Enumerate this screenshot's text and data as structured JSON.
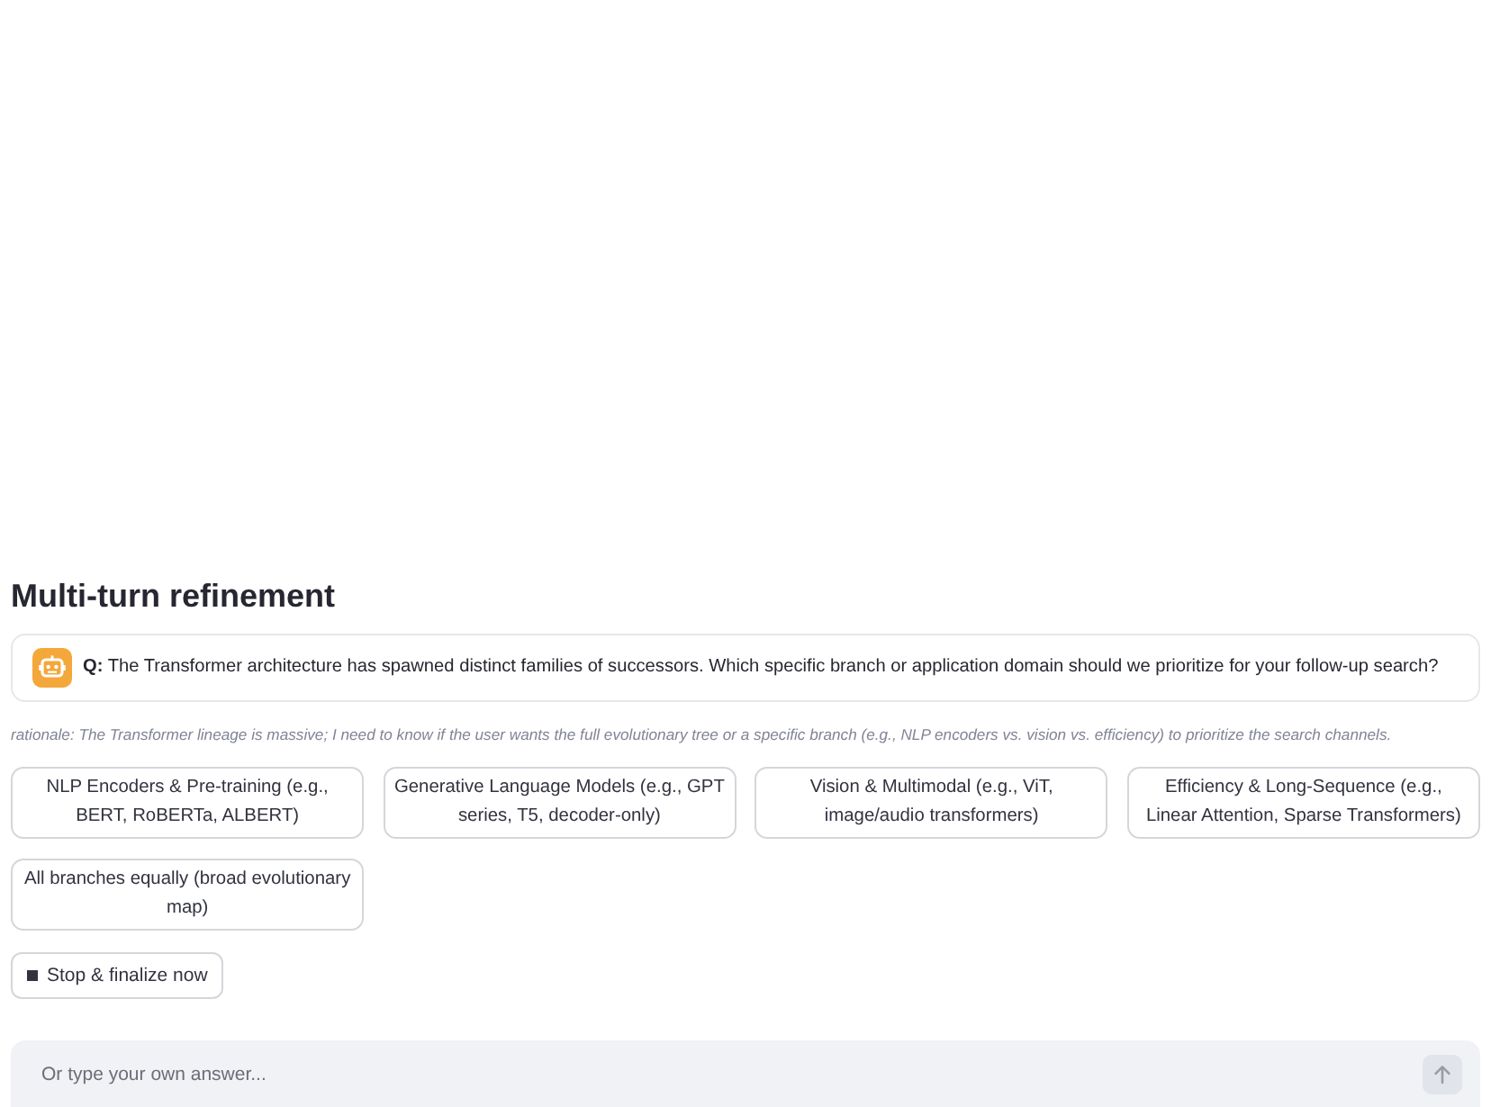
{
  "section": {
    "title": "Multi-turn refinement"
  },
  "question": {
    "text": "**Q:** The Transformer architecture has spawned distinct families of successors. Which specific branch or application domain should we prioritize for your follow-up search?"
  },
  "rationale": "rationale: The Transformer lineage is massive; I need to know if the user wants the full evolutionary tree or a specific branch (e.g., NLP encoders vs. vision vs. efficiency) to prioritize the search channels.",
  "options": [
    {
      "label": "NLP Encoders & Pre-training (e.g., BERT, RoBERTa, ALBERT)"
    },
    {
      "label": "Generative Language Models (e.g., GPT series, T5, decoder-only)"
    },
    {
      "label": "Vision & Multimodal (e.g., ViT, image/audio transformers)"
    },
    {
      "label": "Efficiency & Long-Sequence (e.g., Linear Attention, Sparse Transformers)"
    },
    {
      "label": "All branches equally (broad evolutionary map)"
    }
  ],
  "stop_button": {
    "label": "Stop & finalize now"
  },
  "chat_input": {
    "placeholder": "Or type your own answer...",
    "send_disabled": true
  }
}
